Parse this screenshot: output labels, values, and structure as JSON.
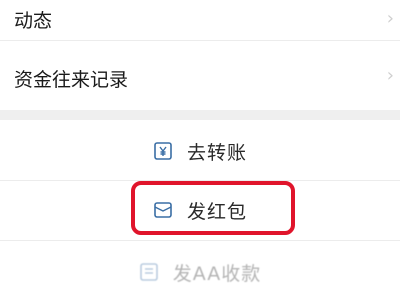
{
  "menu": {
    "items": [
      {
        "label": "动态",
        "icon": "chevron-right-icon"
      },
      {
        "label": "资金往来记录",
        "icon": "chevron-right-icon"
      }
    ]
  },
  "action_sheet": {
    "items": [
      {
        "label": "去转账",
        "icon": "transfer-yen-icon"
      },
      {
        "label": "发红包",
        "icon": "red-envelope-icon"
      },
      {
        "label": "发AA收款",
        "icon": "aa-collect-icon"
      }
    ]
  },
  "highlight_color": "#e0142b"
}
